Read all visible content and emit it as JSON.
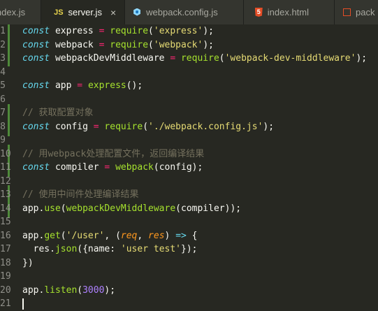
{
  "tabs": [
    {
      "label": "index.js",
      "icon": "js-icon",
      "active": false,
      "truncated_left": true
    },
    {
      "label": "server.js",
      "icon": "js-icon",
      "active": true,
      "close": "×"
    },
    {
      "label": "webpack.config.js",
      "icon": "webpack-icon",
      "active": false
    },
    {
      "label": "index.html",
      "icon": "html5-icon",
      "active": false
    },
    {
      "label": "pack",
      "icon": "file-icon",
      "active": false,
      "truncated_right": true
    }
  ],
  "icons": {
    "js_glyph": "JS",
    "html_glyph": "5"
  },
  "editor": {
    "lines": [
      {
        "n": "1",
        "tokens": [
          [
            "k",
            "const"
          ],
          [
            "t",
            " express "
          ],
          [
            "o",
            "="
          ],
          [
            "t",
            " "
          ],
          [
            "f",
            "require"
          ],
          [
            "t",
            "("
          ],
          [
            "s",
            "'express'"
          ],
          [
            "t",
            ");"
          ]
        ]
      },
      {
        "n": "2",
        "tokens": [
          [
            "k",
            "const"
          ],
          [
            "t",
            " webpack "
          ],
          [
            "o",
            "="
          ],
          [
            "t",
            " "
          ],
          [
            "f",
            "require"
          ],
          [
            "t",
            "("
          ],
          [
            "s",
            "'webpack'"
          ],
          [
            "t",
            ");"
          ]
        ]
      },
      {
        "n": "3",
        "tokens": [
          [
            "k",
            "const"
          ],
          [
            "t",
            " webpackDevMiddleware "
          ],
          [
            "o",
            "="
          ],
          [
            "t",
            " "
          ],
          [
            "f",
            "require"
          ],
          [
            "t",
            "("
          ],
          [
            "s",
            "'webpack-dev-middleware'"
          ],
          [
            "t",
            ");"
          ]
        ]
      },
      {
        "n": "4",
        "tokens": []
      },
      {
        "n": "5",
        "tokens": [
          [
            "k",
            "const"
          ],
          [
            "t",
            " app "
          ],
          [
            "o",
            "="
          ],
          [
            "t",
            " "
          ],
          [
            "f",
            "express"
          ],
          [
            "t",
            "();"
          ]
        ]
      },
      {
        "n": "6",
        "tokens": []
      },
      {
        "n": "7",
        "tokens": [
          [
            "c",
            "// 获取配置对象"
          ]
        ]
      },
      {
        "n": "8",
        "tokens": [
          [
            "k",
            "const"
          ],
          [
            "t",
            " config "
          ],
          [
            "o",
            "="
          ],
          [
            "t",
            " "
          ],
          [
            "f",
            "require"
          ],
          [
            "t",
            "("
          ],
          [
            "s",
            "'./webpack.config.js'"
          ],
          [
            "t",
            ");"
          ]
        ]
      },
      {
        "n": "9",
        "tokens": []
      },
      {
        "n": "10",
        "tokens": [
          [
            "c",
            "// 用webpack处理配置文件，返回编译结果"
          ]
        ]
      },
      {
        "n": "11",
        "tokens": [
          [
            "k",
            "const"
          ],
          [
            "t",
            " compiler "
          ],
          [
            "o",
            "="
          ],
          [
            "t",
            " "
          ],
          [
            "f",
            "webpack"
          ],
          [
            "t",
            "(config);"
          ]
        ]
      },
      {
        "n": "12",
        "tokens": []
      },
      {
        "n": "13",
        "tokens": [
          [
            "c",
            "// 使用中间件处理编译结果"
          ]
        ]
      },
      {
        "n": "14",
        "tokens": [
          [
            "t",
            "app."
          ],
          [
            "f",
            "use"
          ],
          [
            "t",
            "("
          ],
          [
            "f",
            "webpackDevMiddleware"
          ],
          [
            "t",
            "(compiler));"
          ]
        ]
      },
      {
        "n": "15",
        "tokens": []
      },
      {
        "n": "16",
        "tokens": [
          [
            "t",
            "app."
          ],
          [
            "f",
            "get"
          ],
          [
            "t",
            "("
          ],
          [
            "s",
            "'/user'"
          ],
          [
            "t",
            ", ("
          ],
          [
            "p",
            "req"
          ],
          [
            "t",
            ", "
          ],
          [
            "p",
            "res"
          ],
          [
            "t",
            ") "
          ],
          [
            "k",
            "=>"
          ],
          [
            "t",
            " {"
          ]
        ]
      },
      {
        "n": "17",
        "tokens": [
          [
            "t",
            "  res."
          ],
          [
            "f",
            "json"
          ],
          [
            "t",
            "({name: "
          ],
          [
            "s",
            "'user test'"
          ],
          [
            "t",
            "});"
          ]
        ]
      },
      {
        "n": "18",
        "tokens": [
          [
            "t",
            "})"
          ]
        ]
      },
      {
        "n": "19",
        "tokens": []
      },
      {
        "n": "20",
        "tokens": [
          [
            "t",
            "app."
          ],
          [
            "f",
            "listen"
          ],
          [
            "t",
            "("
          ],
          [
            "n",
            "3000"
          ],
          [
            "t",
            ");"
          ]
        ]
      },
      {
        "n": "21",
        "tokens": []
      }
    ]
  }
}
